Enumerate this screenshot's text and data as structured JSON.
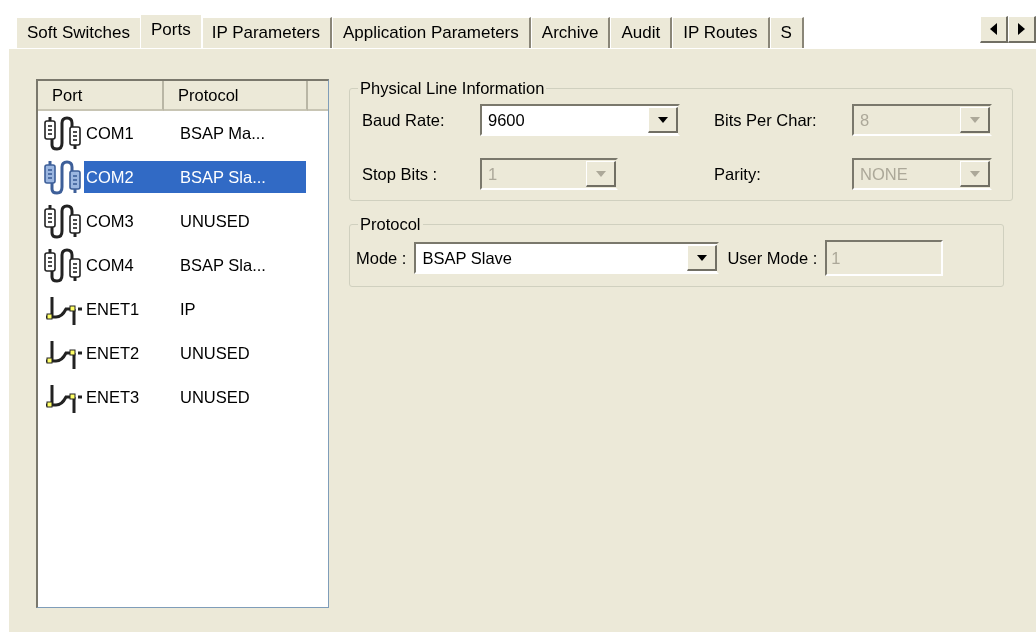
{
  "tabs": [
    {
      "label": "Soft Switches",
      "selected": false
    },
    {
      "label": "Ports",
      "selected": true
    },
    {
      "label": "IP Parameters",
      "selected": false
    },
    {
      "label": "Application Parameters",
      "selected": false
    },
    {
      "label": "Archive",
      "selected": false
    },
    {
      "label": "Audit",
      "selected": false
    },
    {
      "label": "IP Routes",
      "selected": false
    },
    {
      "label": "S",
      "selected": false
    }
  ],
  "port_list": {
    "columns": [
      "Port",
      "Protocol"
    ],
    "rows": [
      {
        "kind": "serial",
        "port": "COM1",
        "protocol": "BSAP Ma...",
        "selected": false
      },
      {
        "kind": "serial",
        "port": "COM2",
        "protocol": "BSAP Sla...",
        "selected": true
      },
      {
        "kind": "serial",
        "port": "COM3",
        "protocol": "UNUSED",
        "selected": false
      },
      {
        "kind": "serial",
        "port": "COM4",
        "protocol": "BSAP Sla...",
        "selected": false
      },
      {
        "kind": "ethernet",
        "port": "ENET1",
        "protocol": "IP",
        "selected": false
      },
      {
        "kind": "ethernet",
        "port": "ENET2",
        "protocol": "UNUSED",
        "selected": false
      },
      {
        "kind": "ethernet",
        "port": "ENET3",
        "protocol": "UNUSED",
        "selected": false
      }
    ]
  },
  "physical_line_information": {
    "title": "Physical Line Information",
    "fields": [
      {
        "kind": "combo",
        "label": "Baud Rate:",
        "value": "9600",
        "disabled": false
      },
      {
        "kind": "combo",
        "label": "Bits Per Char:",
        "value": "8",
        "disabled": true
      },
      {
        "kind": "combo",
        "label": "Stop Bits :",
        "value": "1",
        "disabled": true
      },
      {
        "kind": "combo",
        "label": "Parity:",
        "value": "NONE",
        "disabled": true
      }
    ]
  },
  "protocol": {
    "title": "Protocol",
    "fields": [
      {
        "kind": "combo",
        "label": "Mode :",
        "value": "BSAP Slave",
        "disabled": false
      },
      {
        "kind": "text",
        "label": "User Mode :",
        "value": "1",
        "disabled": true
      }
    ]
  }
}
